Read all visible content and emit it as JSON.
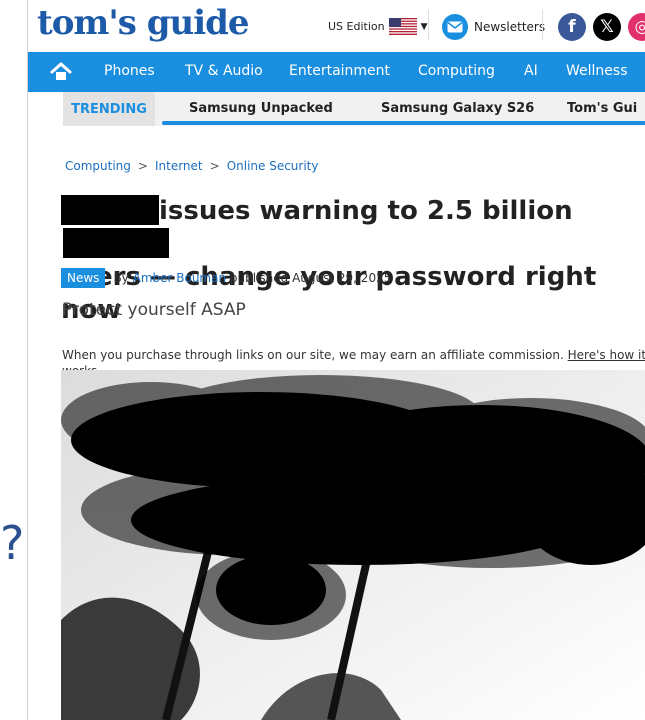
{
  "side_glyph": "?",
  "header": {
    "logo": "tom's guide",
    "edition": "US Edition",
    "newsletters": "Newsletters",
    "social": [
      {
        "name": "facebook",
        "glyph": "f",
        "color": "#3b5998"
      },
      {
        "name": "x",
        "glyph": "𝕏",
        "color": "#000000"
      },
      {
        "name": "instagram",
        "glyph": "◎",
        "color": "#e1306c"
      }
    ]
  },
  "nav": {
    "items": [
      "Phones",
      "TV & Audio",
      "Entertainment",
      "Computing",
      "AI",
      "Wellness"
    ]
  },
  "trending": {
    "label": "TRENDING",
    "items": [
      "Samsung Unpacked",
      "Samsung Galaxy S26",
      "Tom's Gui"
    ]
  },
  "breadcrumb": [
    "Computing",
    "Internet",
    "Online Security"
  ],
  "breadcrumb_sep": ">",
  "article": {
    "headline_part1": "issues warning to 2.5 billion",
    "headline_part2": "users — change your password right now",
    "badge": "News",
    "byline_prefix": "By",
    "author": "Amber Bouman",
    "published": "published August 29, 2025",
    "subhead": "Protect yourself ASAP",
    "disclaimer_text": "When you purchase through links on our site, we may earn an affiliate commission.",
    "disclaimer_link": "Here's how it works",
    "disclaimer_end": "."
  },
  "colors": {
    "brand_blue": "#1d5aa8",
    "nav_blue": "#1a8fe0"
  }
}
